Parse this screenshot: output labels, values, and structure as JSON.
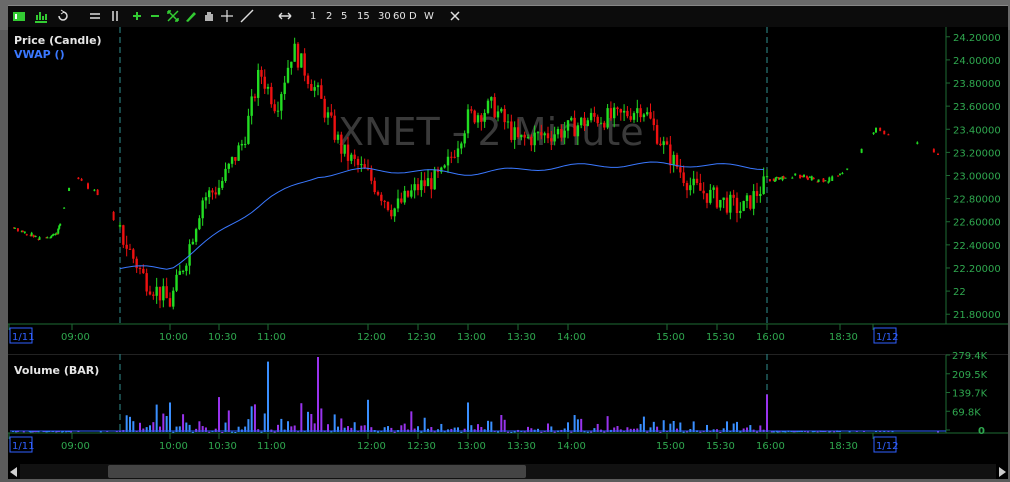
{
  "toolbar": {
    "periods": [
      "1",
      "2",
      "5",
      "15",
      "30",
      "60",
      "D",
      "W"
    ],
    "icons": [
      "candle-chart-icon",
      "bar-chart-icon",
      "refresh-icon",
      "horizontal-lines-icon",
      "vertical-lines-icon",
      "zoom-in-icon",
      "zoom-out-icon",
      "fit-icon",
      "pencil-icon",
      "hand-icon",
      "crosshair-icon",
      "line-tool-icon",
      "pan-icon",
      "close-icon"
    ]
  },
  "chart_data": [
    {
      "type": "candlestick",
      "title": "XNET - 2 Minute",
      "series": [
        {
          "name": "Price (Candle)",
          "color": "#e6e6e6"
        },
        {
          "name": "VWAP ()",
          "color": "#3a78ff"
        }
      ],
      "yticks": [
        "24.20000",
        "24.00000",
        "23.80000",
        "23.60000",
        "23.40000",
        "23.20000",
        "23.00000",
        "22.80000",
        "22.60000",
        "22.40000",
        "22.20000",
        "22",
        "21.80000"
      ],
      "ylim": [
        21.75,
        24.25
      ],
      "xticks": [
        "1/11",
        "09:00",
        "10:00",
        "10:30",
        "11:00",
        "12:00",
        "12:30",
        "13:00",
        "13:30",
        "14:00",
        "15:00",
        "15:30",
        "16:00",
        "18:30",
        "1/12"
      ],
      "session_start": "09:30",
      "session_end": "16:00",
      "candle_colors": {
        "up": "#22dd22",
        "down": "#ee1111"
      },
      "price_path": [
        [
          "07:00",
          22.55
        ],
        [
          "08:00",
          22.45
        ],
        [
          "08:30",
          22.5
        ],
        [
          "09:00",
          23.0
        ],
        [
          "09:20",
          22.8
        ],
        [
          "09:30",
          22.5
        ],
        [
          "09:45",
          22.1
        ],
        [
          "10:00",
          21.9
        ],
        [
          "10:10",
          22.3
        ],
        [
          "10:20",
          22.8
        ],
        [
          "10:30",
          22.9
        ],
        [
          "10:45",
          23.3
        ],
        [
          "10:55",
          23.9
        ],
        [
          "11:05",
          23.6
        ],
        [
          "11:15",
          24.1
        ],
        [
          "11:30",
          23.7
        ],
        [
          "11:45",
          23.2
        ],
        [
          "12:00",
          23.0
        ],
        [
          "12:15",
          22.7
        ],
        [
          "12:30",
          22.9
        ],
        [
          "12:45",
          23.0
        ],
        [
          "13:00",
          23.5
        ],
        [
          "13:15",
          23.6
        ],
        [
          "13:30",
          23.3
        ],
        [
          "14:00",
          23.4
        ],
        [
          "14:15",
          23.5
        ],
        [
          "14:30",
          23.5
        ],
        [
          "14:45",
          23.6
        ],
        [
          "15:00",
          23.2
        ],
        [
          "15:15",
          22.9
        ],
        [
          "15:30",
          22.8
        ],
        [
          "15:45",
          22.7
        ],
        [
          "16:00",
          22.95
        ],
        [
          "17:00",
          23.0
        ],
        [
          "18:00",
          22.95
        ],
        [
          "18:30",
          23.0
        ],
        [
          "19:00",
          23.4
        ],
        [
          "19:30",
          23.2
        ]
      ],
      "vwap": [
        [
          "09:30",
          22.2
        ],
        [
          "10:00",
          22.2
        ],
        [
          "10:30",
          22.5
        ],
        [
          "11:00",
          22.8
        ],
        [
          "11:30",
          23.0
        ],
        [
          "12:00",
          23.05
        ],
        [
          "13:00",
          23.02
        ],
        [
          "14:00",
          23.08
        ],
        [
          "15:00",
          23.1
        ],
        [
          "16:00",
          23.07
        ]
      ]
    },
    {
      "type": "bar",
      "title": "Volume (BAR)",
      "yticks": [
        "279.4K",
        "209.5K",
        "139.7K",
        "69.8K",
        "0"
      ],
      "ylim": [
        0,
        279.4
      ],
      "unit": "K",
      "colors": {
        "up": "#3a8fff",
        "down": "#9933ee"
      },
      "notable_values": [
        [
          "10:00",
          110
        ],
        [
          "10:30",
          130
        ],
        [
          "11:00",
          210
        ],
        [
          "11:30",
          279.4
        ],
        [
          "12:00",
          120
        ],
        [
          "13:00",
          110
        ],
        [
          "15:45",
          90
        ],
        [
          "16:00",
          139.7
        ]
      ]
    }
  ]
}
